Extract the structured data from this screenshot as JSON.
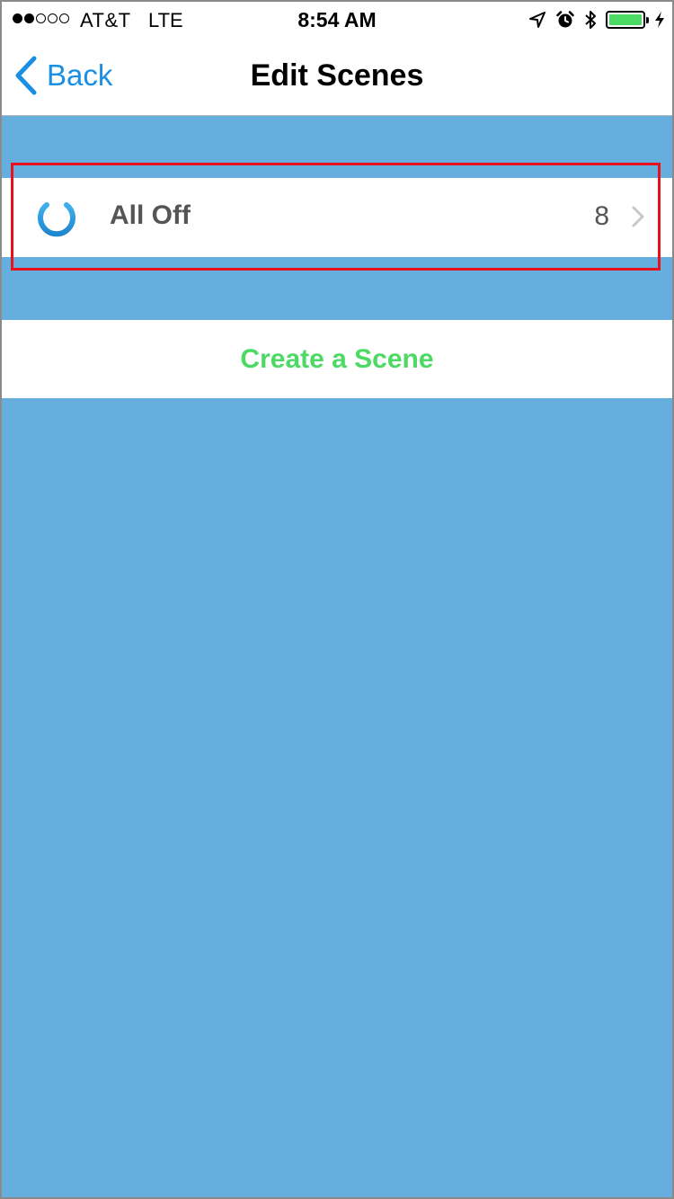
{
  "status_bar": {
    "carrier": "AT&T",
    "network": "LTE",
    "time": "8:54 AM",
    "signal_strength": 2,
    "signal_total": 5,
    "battery_level": 1.0,
    "icons": [
      "location-arrow-icon",
      "alarm-clock-icon",
      "bluetooth-icon",
      "battery-icon",
      "charging-bolt-icon"
    ]
  },
  "nav": {
    "back_label": "Back",
    "title": "Edit Scenes"
  },
  "scenes": [
    {
      "name": "All Off",
      "count": "8",
      "icon": "power-icon"
    }
  ],
  "create": {
    "label": "Create a Scene"
  },
  "colors": {
    "background": "#66aedd",
    "accent_blue": "#1a8fe3",
    "create_green": "#4cd964",
    "highlight_red": "#e8101a",
    "row_text": "#555555"
  }
}
